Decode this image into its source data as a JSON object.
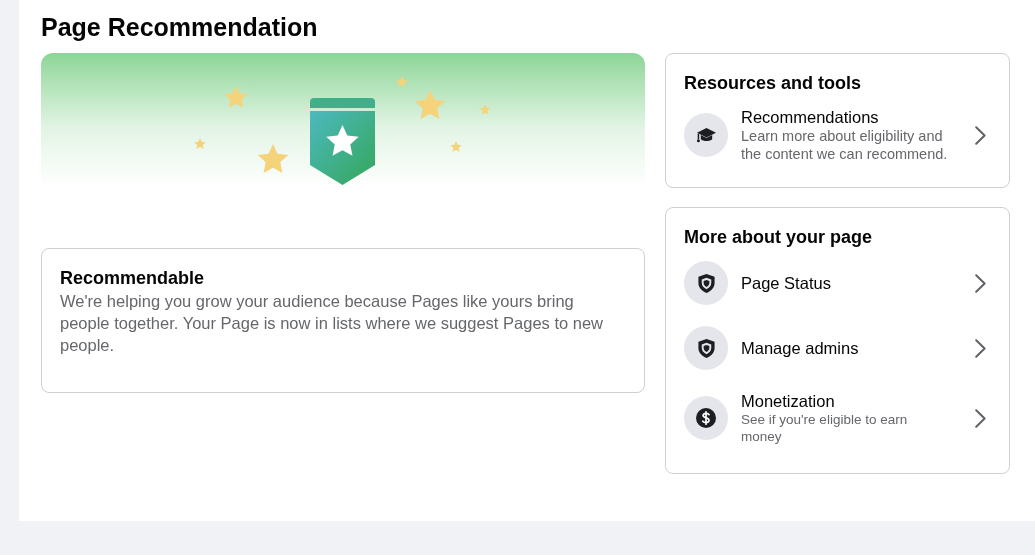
{
  "page": {
    "title": "Page Recommendation"
  },
  "status_card": {
    "title": "Recommendable",
    "description": "We're helping you grow your audience because Pages like yours bring people together. Your Page is now in lists where we suggest Pages to new people."
  },
  "resources": {
    "title": "Resources and tools",
    "items": [
      {
        "title": "Recommendations",
        "subtitle": "Learn more about eligibility and the content we can recommend."
      }
    ]
  },
  "more": {
    "title": "More about your page",
    "items": [
      {
        "title": "Page Status"
      },
      {
        "title": "Manage admins"
      },
      {
        "title": "Monetization",
        "subtitle": "See if you're eligible to earn money"
      }
    ]
  }
}
